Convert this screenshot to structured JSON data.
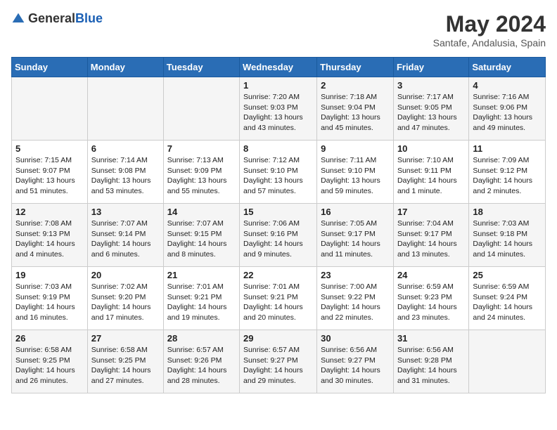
{
  "header": {
    "logo_general": "General",
    "logo_blue": "Blue",
    "month_year": "May 2024",
    "location": "Santafe, Andalusia, Spain"
  },
  "weekdays": [
    "Sunday",
    "Monday",
    "Tuesday",
    "Wednesday",
    "Thursday",
    "Friday",
    "Saturday"
  ],
  "weeks": [
    [
      {
        "day": "",
        "sunrise": "",
        "sunset": "",
        "daylight": ""
      },
      {
        "day": "",
        "sunrise": "",
        "sunset": "",
        "daylight": ""
      },
      {
        "day": "",
        "sunrise": "",
        "sunset": "",
        "daylight": ""
      },
      {
        "day": "1",
        "sunrise": "Sunrise: 7:20 AM",
        "sunset": "Sunset: 9:03 PM",
        "daylight": "Daylight: 13 hours and 43 minutes."
      },
      {
        "day": "2",
        "sunrise": "Sunrise: 7:18 AM",
        "sunset": "Sunset: 9:04 PM",
        "daylight": "Daylight: 13 hours and 45 minutes."
      },
      {
        "day": "3",
        "sunrise": "Sunrise: 7:17 AM",
        "sunset": "Sunset: 9:05 PM",
        "daylight": "Daylight: 13 hours and 47 minutes."
      },
      {
        "day": "4",
        "sunrise": "Sunrise: 7:16 AM",
        "sunset": "Sunset: 9:06 PM",
        "daylight": "Daylight: 13 hours and 49 minutes."
      }
    ],
    [
      {
        "day": "5",
        "sunrise": "Sunrise: 7:15 AM",
        "sunset": "Sunset: 9:07 PM",
        "daylight": "Daylight: 13 hours and 51 minutes."
      },
      {
        "day": "6",
        "sunrise": "Sunrise: 7:14 AM",
        "sunset": "Sunset: 9:08 PM",
        "daylight": "Daylight: 13 hours and 53 minutes."
      },
      {
        "day": "7",
        "sunrise": "Sunrise: 7:13 AM",
        "sunset": "Sunset: 9:09 PM",
        "daylight": "Daylight: 13 hours and 55 minutes."
      },
      {
        "day": "8",
        "sunrise": "Sunrise: 7:12 AM",
        "sunset": "Sunset: 9:10 PM",
        "daylight": "Daylight: 13 hours and 57 minutes."
      },
      {
        "day": "9",
        "sunrise": "Sunrise: 7:11 AM",
        "sunset": "Sunset: 9:10 PM",
        "daylight": "Daylight: 13 hours and 59 minutes."
      },
      {
        "day": "10",
        "sunrise": "Sunrise: 7:10 AM",
        "sunset": "Sunset: 9:11 PM",
        "daylight": "Daylight: 14 hours and 1 minute."
      },
      {
        "day": "11",
        "sunrise": "Sunrise: 7:09 AM",
        "sunset": "Sunset: 9:12 PM",
        "daylight": "Daylight: 14 hours and 2 minutes."
      }
    ],
    [
      {
        "day": "12",
        "sunrise": "Sunrise: 7:08 AM",
        "sunset": "Sunset: 9:13 PM",
        "daylight": "Daylight: 14 hours and 4 minutes."
      },
      {
        "day": "13",
        "sunrise": "Sunrise: 7:07 AM",
        "sunset": "Sunset: 9:14 PM",
        "daylight": "Daylight: 14 hours and 6 minutes."
      },
      {
        "day": "14",
        "sunrise": "Sunrise: 7:07 AM",
        "sunset": "Sunset: 9:15 PM",
        "daylight": "Daylight: 14 hours and 8 minutes."
      },
      {
        "day": "15",
        "sunrise": "Sunrise: 7:06 AM",
        "sunset": "Sunset: 9:16 PM",
        "daylight": "Daylight: 14 hours and 9 minutes."
      },
      {
        "day": "16",
        "sunrise": "Sunrise: 7:05 AM",
        "sunset": "Sunset: 9:17 PM",
        "daylight": "Daylight: 14 hours and 11 minutes."
      },
      {
        "day": "17",
        "sunrise": "Sunrise: 7:04 AM",
        "sunset": "Sunset: 9:17 PM",
        "daylight": "Daylight: 14 hours and 13 minutes."
      },
      {
        "day": "18",
        "sunrise": "Sunrise: 7:03 AM",
        "sunset": "Sunset: 9:18 PM",
        "daylight": "Daylight: 14 hours and 14 minutes."
      }
    ],
    [
      {
        "day": "19",
        "sunrise": "Sunrise: 7:03 AM",
        "sunset": "Sunset: 9:19 PM",
        "daylight": "Daylight: 14 hours and 16 minutes."
      },
      {
        "day": "20",
        "sunrise": "Sunrise: 7:02 AM",
        "sunset": "Sunset: 9:20 PM",
        "daylight": "Daylight: 14 hours and 17 minutes."
      },
      {
        "day": "21",
        "sunrise": "Sunrise: 7:01 AM",
        "sunset": "Sunset: 9:21 PM",
        "daylight": "Daylight: 14 hours and 19 minutes."
      },
      {
        "day": "22",
        "sunrise": "Sunrise: 7:01 AM",
        "sunset": "Sunset: 9:21 PM",
        "daylight": "Daylight: 14 hours and 20 minutes."
      },
      {
        "day": "23",
        "sunrise": "Sunrise: 7:00 AM",
        "sunset": "Sunset: 9:22 PM",
        "daylight": "Daylight: 14 hours and 22 minutes."
      },
      {
        "day": "24",
        "sunrise": "Sunrise: 6:59 AM",
        "sunset": "Sunset: 9:23 PM",
        "daylight": "Daylight: 14 hours and 23 minutes."
      },
      {
        "day": "25",
        "sunrise": "Sunrise: 6:59 AM",
        "sunset": "Sunset: 9:24 PM",
        "daylight": "Daylight: 14 hours and 24 minutes."
      }
    ],
    [
      {
        "day": "26",
        "sunrise": "Sunrise: 6:58 AM",
        "sunset": "Sunset: 9:25 PM",
        "daylight": "Daylight: 14 hours and 26 minutes."
      },
      {
        "day": "27",
        "sunrise": "Sunrise: 6:58 AM",
        "sunset": "Sunset: 9:25 PM",
        "daylight": "Daylight: 14 hours and 27 minutes."
      },
      {
        "day": "28",
        "sunrise": "Sunrise: 6:57 AM",
        "sunset": "Sunset: 9:26 PM",
        "daylight": "Daylight: 14 hours and 28 minutes."
      },
      {
        "day": "29",
        "sunrise": "Sunrise: 6:57 AM",
        "sunset": "Sunset: 9:27 PM",
        "daylight": "Daylight: 14 hours and 29 minutes."
      },
      {
        "day": "30",
        "sunrise": "Sunrise: 6:56 AM",
        "sunset": "Sunset: 9:27 PM",
        "daylight": "Daylight: 14 hours and 30 minutes."
      },
      {
        "day": "31",
        "sunrise": "Sunrise: 6:56 AM",
        "sunset": "Sunset: 9:28 PM",
        "daylight": "Daylight: 14 hours and 31 minutes."
      },
      {
        "day": "",
        "sunrise": "",
        "sunset": "",
        "daylight": ""
      }
    ]
  ]
}
